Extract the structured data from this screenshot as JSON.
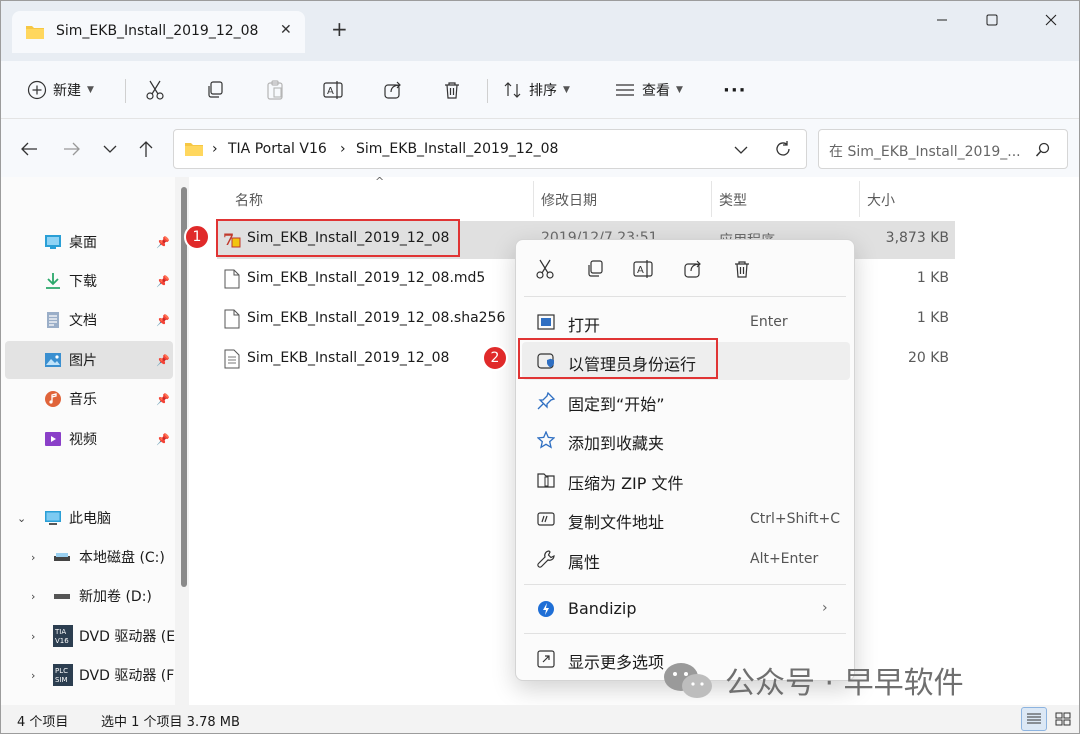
{
  "window": {
    "tab_title": "Sim_EKB_Install_2019_12_08",
    "close_tab": "✕",
    "new_tab": "+",
    "minimize": "—",
    "maximize": "☐",
    "close": "✕"
  },
  "toolbar": {
    "new_label": "新建",
    "sort_label": "排序",
    "view_label": "查看",
    "more_label": "···",
    "icons": [
      "cut-icon",
      "copy-icon",
      "paste-icon",
      "rename-icon",
      "share-icon",
      "delete-icon"
    ]
  },
  "address": {
    "crumbs": [
      "TIA Portal V16",
      "Sim_EKB_Install_2019_12_08"
    ],
    "separator": "›",
    "search_placeholder": "在 Sim_EKB_Install_2019_..."
  },
  "sidebar": {
    "quick_access": [
      {
        "label": "桌面",
        "icon": "desktop-icon",
        "color": "#2a9fd6"
      },
      {
        "label": "下载",
        "icon": "download-icon",
        "color": "#2aa86a"
      },
      {
        "label": "文档",
        "icon": "documents-icon",
        "color": "#6b7fa8"
      },
      {
        "label": "图片",
        "icon": "pictures-icon",
        "color": "#3a8fd0"
      },
      {
        "label": "音乐",
        "icon": "music-icon",
        "color": "#e0643a"
      },
      {
        "label": "视频",
        "icon": "videos-icon",
        "color": "#8a3fc8"
      }
    ],
    "this_pc": "此电脑",
    "drives": [
      "本地磁盘 (C:)",
      "新加卷 (D:)",
      "DVD 驱动器 (E",
      "DVD 驱动器 (F"
    ],
    "drive_badges": [
      "TIA V16",
      "PLC SIM"
    ]
  },
  "columns": {
    "name": "名称",
    "date": "修改日期",
    "type": "类型",
    "size": "大小"
  },
  "files": [
    {
      "name": "Sim_EKB_Install_2019_12_08",
      "date": "2019/12/7 23:51",
      "type": "应用程序",
      "size": "3,873 KB",
      "icon": "exe-icon"
    },
    {
      "name": "Sim_EKB_Install_2019_12_08.md5",
      "size": "1 KB",
      "icon": "file-icon"
    },
    {
      "name": "Sim_EKB_Install_2019_12_08.sha256",
      "size": "1 KB",
      "icon": "file-icon"
    },
    {
      "name": "Sim_EKB_Install_2019_12_08",
      "size": "20 KB",
      "icon": "text-file-icon"
    }
  ],
  "context_menu": {
    "items": [
      {
        "label": "打开",
        "shortcut": "Enter",
        "icon": "open-icon"
      },
      {
        "label": "以管理员身份运行",
        "shortcut": "",
        "icon": "shield-icon"
      },
      {
        "label": "固定到“开始”",
        "shortcut": "",
        "icon": "pin-icon"
      },
      {
        "label": "添加到收藏夹",
        "shortcut": "",
        "icon": "star-icon"
      },
      {
        "label": "压缩为 ZIP 文件",
        "shortcut": "",
        "icon": "zip-icon"
      },
      {
        "label": "复制文件地址",
        "shortcut": "Ctrl+Shift+C",
        "icon": "copy-path-icon"
      },
      {
        "label": "属性",
        "shortcut": "Alt+Enter",
        "icon": "wrench-icon"
      },
      {
        "label": "Bandizip",
        "shortcut": "",
        "icon": "bandizip-icon",
        "submenu": "›"
      },
      {
        "label": "显示更多选项",
        "shortcut": "",
        "icon": "more-options-icon"
      }
    ]
  },
  "markers": [
    "1",
    "2"
  ],
  "status": {
    "count": "4 个项目",
    "selected": "选中 1 个项目  3.78 MB"
  },
  "watermark": {
    "text": "公众号 · 早早软件"
  }
}
